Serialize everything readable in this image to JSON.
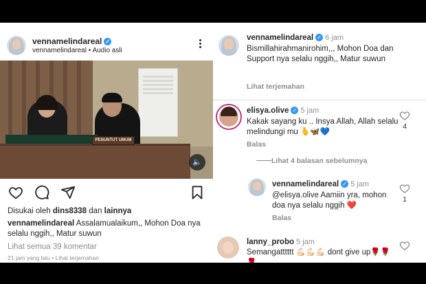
{
  "post": {
    "username": "vennamelindareal",
    "subline": "vennamelindareal • Audio asli",
    "photo_nameplate": "PENUNTUT UMUM",
    "liked_by_prefix": "Disukai oleh ",
    "liked_by_user": "dins8338",
    "liked_by_suffix": " dan ",
    "liked_by_others": "lainnya",
    "caption_user": "vennamelindareal",
    "caption_text": " Assalamualaikum,, Mohon Doa nya selalu nggih,, Matur suwun",
    "view_all_comments": "Lihat semua 39 komentar",
    "time_ago": "21 jam yang lalu",
    "separator": " • ",
    "see_translation": "Lihat terjemahan"
  },
  "comments": {
    "author": {
      "username": "vennamelindareal",
      "time": "6 jam",
      "text": "Bismillahirahmanirohim,,, Mohon Doa dan Support nya selalu nggih,, Matur suwun",
      "translation": "Lihat terjemahan"
    },
    "c1": {
      "username": "elisya.olive",
      "time": "5 jam",
      "text": "Kakak sayang ku .. Insya Allah, Allah selalu melindungi mu 🫰🦋💙",
      "reply": "Balas",
      "likes": "4"
    },
    "view_replies": "Lihat 4 balasan sebelumnya",
    "reply1": {
      "username": "vennamelindareal",
      "time": "5 jam",
      "text": "@elisya.olive Aamiin yra, mohon doa nya selalu nggih ❤️",
      "reply": "Balas",
      "likes": "1"
    },
    "c2": {
      "username": "lanny_probo",
      "time": "5 jam",
      "text": "Semangatttttt 💪🏻💪🏻💪🏻 dont give up🌹🌹🌹"
    }
  },
  "icons": {
    "verified": "verified-badge",
    "more": "more-icon",
    "audio": "speaker-icon",
    "like": "heart-icon",
    "comment": "comment-icon",
    "share": "send-icon",
    "save": "bookmark-icon"
  },
  "colors": {
    "verified": "#3897f0",
    "heart_red": "#ed4956",
    "muted": "#8e8e8e",
    "text": "#262626"
  }
}
